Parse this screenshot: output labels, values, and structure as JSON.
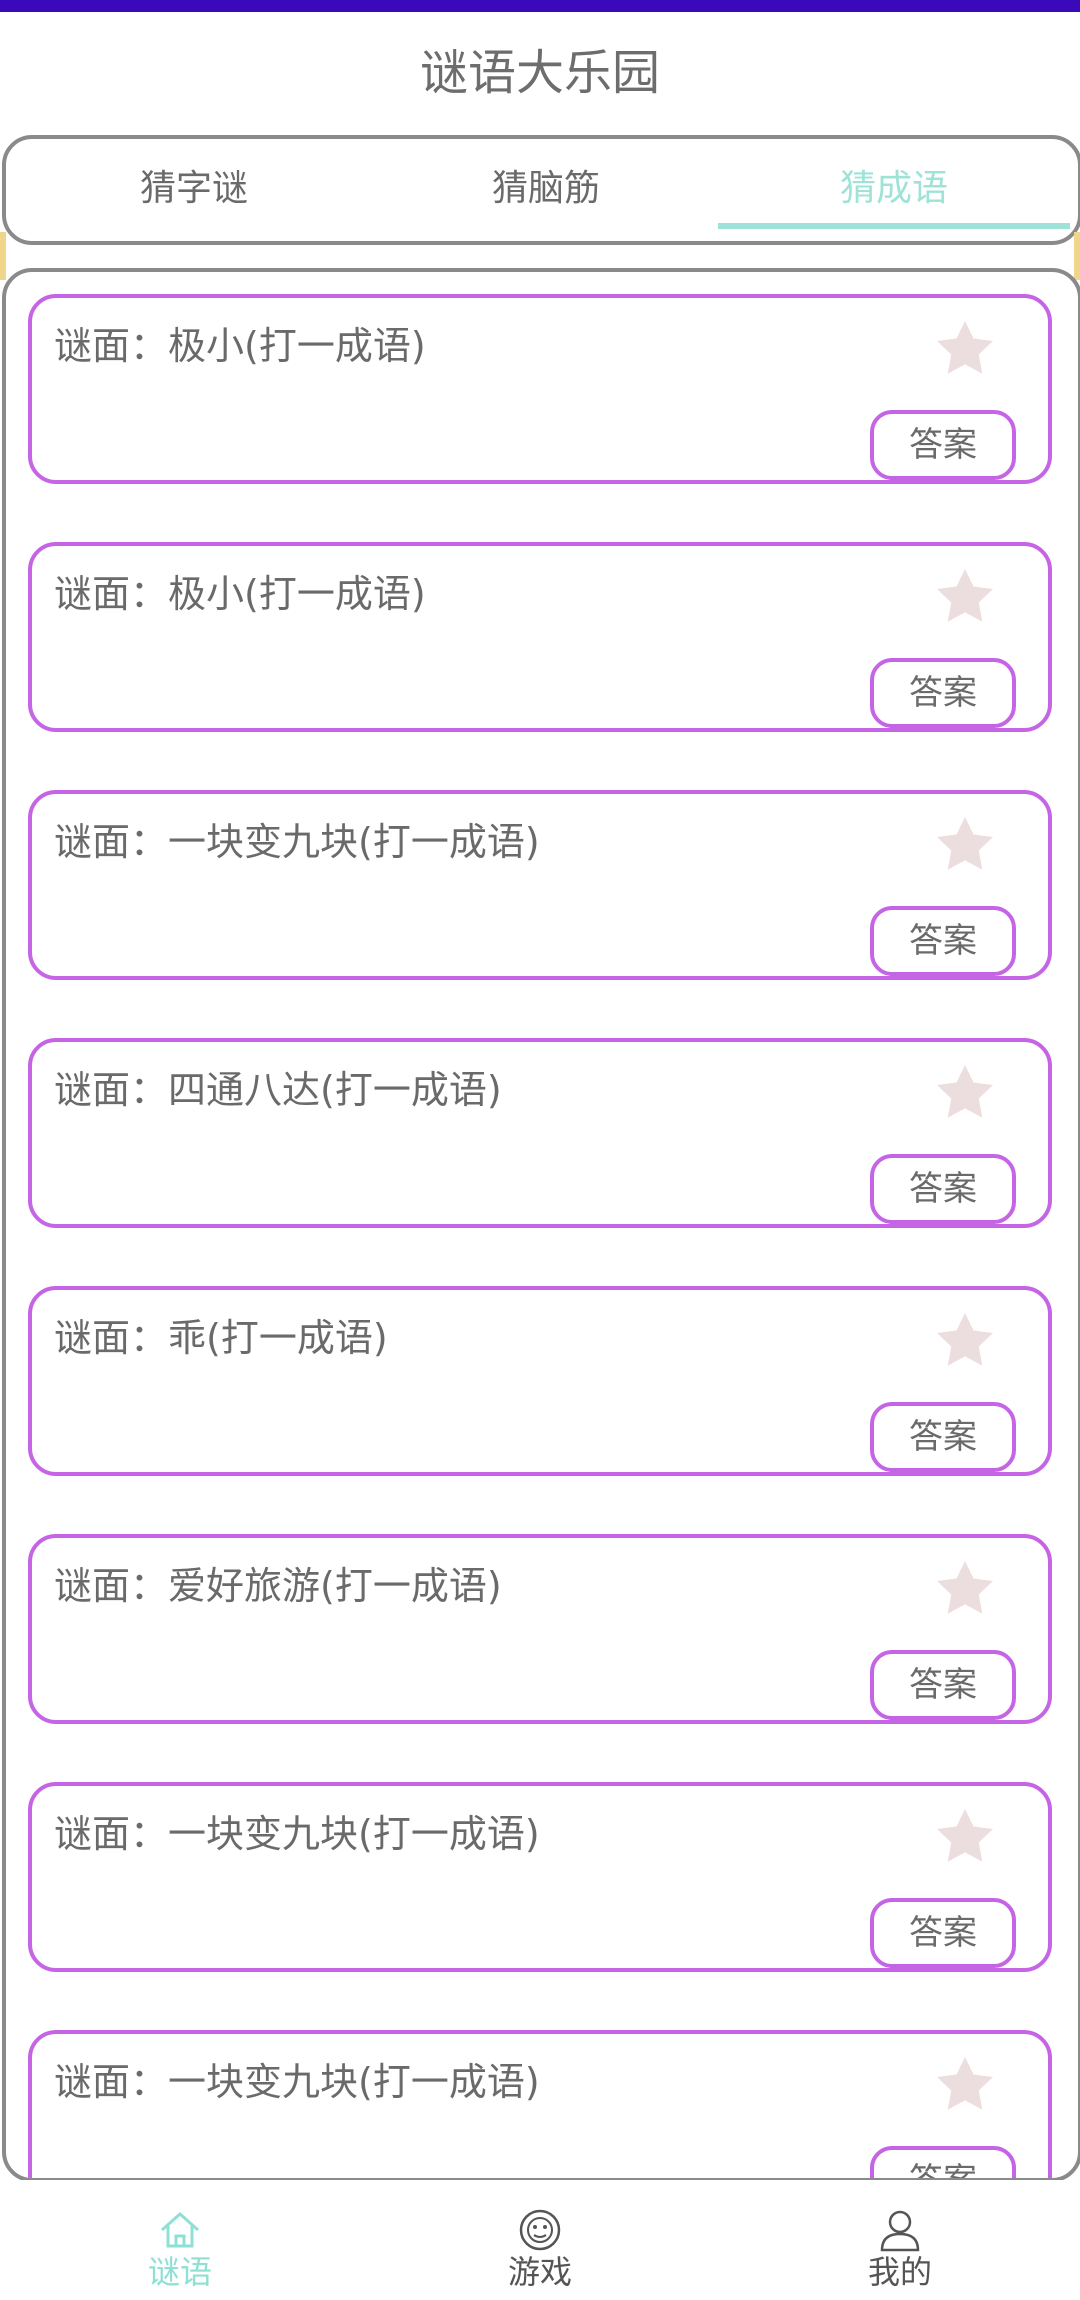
{
  "app": {
    "title": "谜语大乐园"
  },
  "colors": {
    "accent": "#9fe3d8",
    "card_border": "#c565e6",
    "star": "#ecdede",
    "status_bar": "#3a09b9"
  },
  "tabs": [
    {
      "label": "猜字谜",
      "active": false
    },
    {
      "label": "猜脑筋",
      "active": false
    },
    {
      "label": "猜成语",
      "active": true
    }
  ],
  "riddles": [
    {
      "text": "谜面：极小(打一成语)",
      "answer_label": "答案",
      "favorite_icon": "star-icon"
    },
    {
      "text": "谜面：极小(打一成语)",
      "answer_label": "答案",
      "favorite_icon": "star-icon"
    },
    {
      "text": "谜面：一块变九块(打一成语)",
      "answer_label": "答案",
      "favorite_icon": "star-icon"
    },
    {
      "text": "谜面：四通八达(打一成语)",
      "answer_label": "答案",
      "favorite_icon": "star-icon"
    },
    {
      "text": "谜面：乖(打一成语)",
      "answer_label": "答案",
      "favorite_icon": "star-icon"
    },
    {
      "text": "谜面：爱好旅游(打一成语)",
      "answer_label": "答案",
      "favorite_icon": "star-icon"
    },
    {
      "text": "谜面：一块变九块(打一成语)",
      "answer_label": "答案",
      "favorite_icon": "star-icon"
    },
    {
      "text": "谜面：一块变九块(打一成语)",
      "answer_label": "答案",
      "favorite_icon": "star-icon"
    }
  ],
  "nav": [
    {
      "label": "谜语",
      "icon": "home-icon",
      "active": true
    },
    {
      "label": "游戏",
      "icon": "game-icon",
      "active": false
    },
    {
      "label": "我的",
      "icon": "user-icon",
      "active": false
    }
  ]
}
